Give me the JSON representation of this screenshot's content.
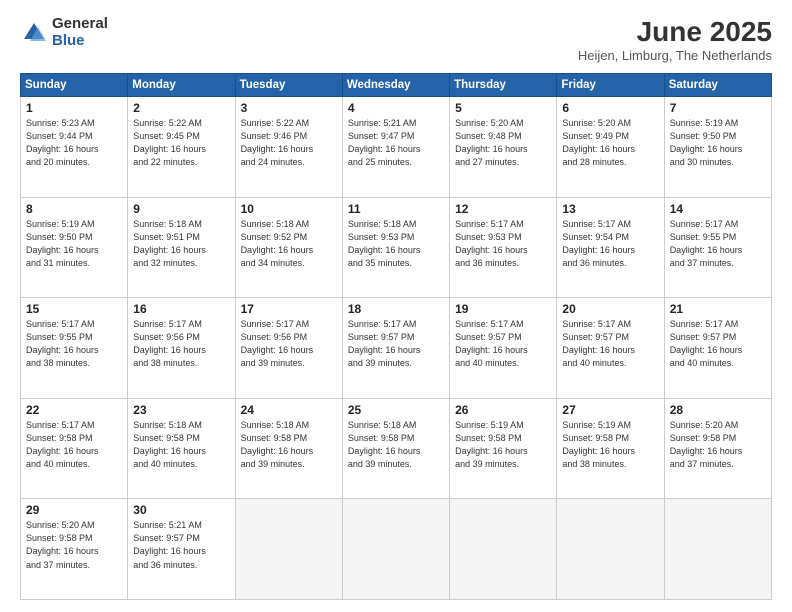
{
  "logo": {
    "general": "General",
    "blue": "Blue"
  },
  "title": "June 2025",
  "subtitle": "Heijen, Limburg, The Netherlands",
  "headers": [
    "Sunday",
    "Monday",
    "Tuesday",
    "Wednesday",
    "Thursday",
    "Friday",
    "Saturday"
  ],
  "weeks": [
    [
      {
        "day": "1",
        "info": "Sunrise: 5:23 AM\nSunset: 9:44 PM\nDaylight: 16 hours\nand 20 minutes."
      },
      {
        "day": "2",
        "info": "Sunrise: 5:22 AM\nSunset: 9:45 PM\nDaylight: 16 hours\nand 22 minutes."
      },
      {
        "day": "3",
        "info": "Sunrise: 5:22 AM\nSunset: 9:46 PM\nDaylight: 16 hours\nand 24 minutes."
      },
      {
        "day": "4",
        "info": "Sunrise: 5:21 AM\nSunset: 9:47 PM\nDaylight: 16 hours\nand 25 minutes."
      },
      {
        "day": "5",
        "info": "Sunrise: 5:20 AM\nSunset: 9:48 PM\nDaylight: 16 hours\nand 27 minutes."
      },
      {
        "day": "6",
        "info": "Sunrise: 5:20 AM\nSunset: 9:49 PM\nDaylight: 16 hours\nand 28 minutes."
      },
      {
        "day": "7",
        "info": "Sunrise: 5:19 AM\nSunset: 9:50 PM\nDaylight: 16 hours\nand 30 minutes."
      }
    ],
    [
      {
        "day": "8",
        "info": "Sunrise: 5:19 AM\nSunset: 9:50 PM\nDaylight: 16 hours\nand 31 minutes."
      },
      {
        "day": "9",
        "info": "Sunrise: 5:18 AM\nSunset: 9:51 PM\nDaylight: 16 hours\nand 32 minutes."
      },
      {
        "day": "10",
        "info": "Sunrise: 5:18 AM\nSunset: 9:52 PM\nDaylight: 16 hours\nand 34 minutes."
      },
      {
        "day": "11",
        "info": "Sunrise: 5:18 AM\nSunset: 9:53 PM\nDaylight: 16 hours\nand 35 minutes."
      },
      {
        "day": "12",
        "info": "Sunrise: 5:17 AM\nSunset: 9:53 PM\nDaylight: 16 hours\nand 36 minutes."
      },
      {
        "day": "13",
        "info": "Sunrise: 5:17 AM\nSunset: 9:54 PM\nDaylight: 16 hours\nand 36 minutes."
      },
      {
        "day": "14",
        "info": "Sunrise: 5:17 AM\nSunset: 9:55 PM\nDaylight: 16 hours\nand 37 minutes."
      }
    ],
    [
      {
        "day": "15",
        "info": "Sunrise: 5:17 AM\nSunset: 9:55 PM\nDaylight: 16 hours\nand 38 minutes."
      },
      {
        "day": "16",
        "info": "Sunrise: 5:17 AM\nSunset: 9:56 PM\nDaylight: 16 hours\nand 38 minutes."
      },
      {
        "day": "17",
        "info": "Sunrise: 5:17 AM\nSunset: 9:56 PM\nDaylight: 16 hours\nand 39 minutes."
      },
      {
        "day": "18",
        "info": "Sunrise: 5:17 AM\nSunset: 9:57 PM\nDaylight: 16 hours\nand 39 minutes."
      },
      {
        "day": "19",
        "info": "Sunrise: 5:17 AM\nSunset: 9:57 PM\nDaylight: 16 hours\nand 40 minutes."
      },
      {
        "day": "20",
        "info": "Sunrise: 5:17 AM\nSunset: 9:57 PM\nDaylight: 16 hours\nand 40 minutes."
      },
      {
        "day": "21",
        "info": "Sunrise: 5:17 AM\nSunset: 9:57 PM\nDaylight: 16 hours\nand 40 minutes."
      }
    ],
    [
      {
        "day": "22",
        "info": "Sunrise: 5:17 AM\nSunset: 9:58 PM\nDaylight: 16 hours\nand 40 minutes."
      },
      {
        "day": "23",
        "info": "Sunrise: 5:18 AM\nSunset: 9:58 PM\nDaylight: 16 hours\nand 40 minutes."
      },
      {
        "day": "24",
        "info": "Sunrise: 5:18 AM\nSunset: 9:58 PM\nDaylight: 16 hours\nand 39 minutes."
      },
      {
        "day": "25",
        "info": "Sunrise: 5:18 AM\nSunset: 9:58 PM\nDaylight: 16 hours\nand 39 minutes."
      },
      {
        "day": "26",
        "info": "Sunrise: 5:19 AM\nSunset: 9:58 PM\nDaylight: 16 hours\nand 39 minutes."
      },
      {
        "day": "27",
        "info": "Sunrise: 5:19 AM\nSunset: 9:58 PM\nDaylight: 16 hours\nand 38 minutes."
      },
      {
        "day": "28",
        "info": "Sunrise: 5:20 AM\nSunset: 9:58 PM\nDaylight: 16 hours\nand 37 minutes."
      }
    ],
    [
      {
        "day": "29",
        "info": "Sunrise: 5:20 AM\nSunset: 9:58 PM\nDaylight: 16 hours\nand 37 minutes."
      },
      {
        "day": "30",
        "info": "Sunrise: 5:21 AM\nSunset: 9:57 PM\nDaylight: 16 hours\nand 36 minutes."
      },
      {
        "day": "",
        "info": ""
      },
      {
        "day": "",
        "info": ""
      },
      {
        "day": "",
        "info": ""
      },
      {
        "day": "",
        "info": ""
      },
      {
        "day": "",
        "info": ""
      }
    ]
  ]
}
